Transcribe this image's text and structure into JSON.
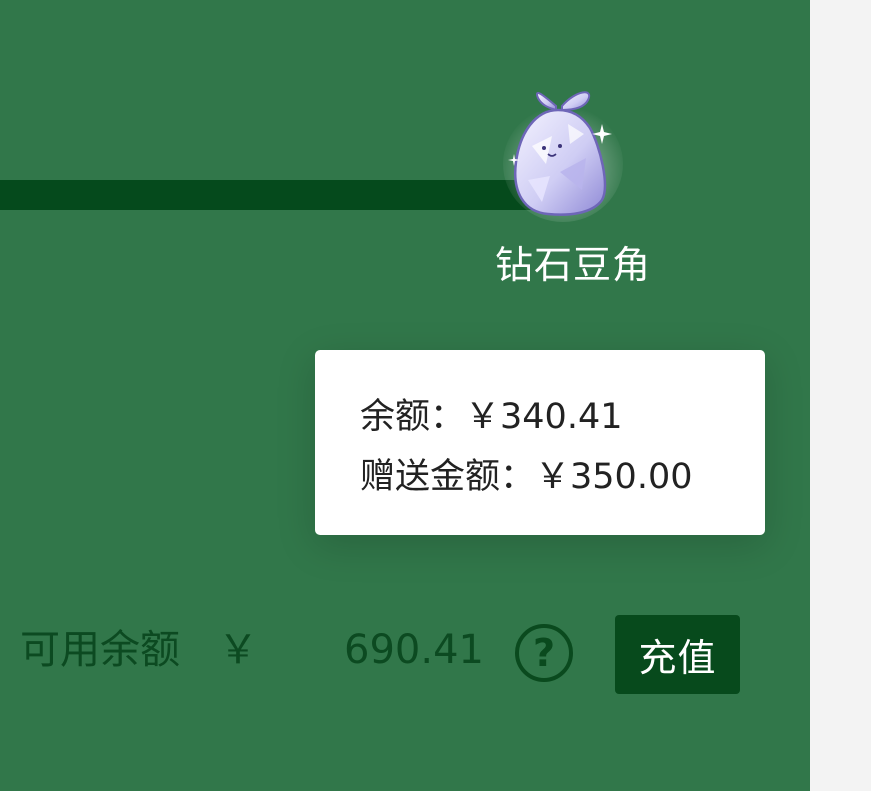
{
  "level": {
    "name": "钻石豆角",
    "mascot_icon": "diamond-bean-mascot-icon"
  },
  "balance_tooltip": {
    "balance_label": "余额：",
    "balance_value": "￥340.41",
    "bonus_label": "赠送金额：",
    "bonus_value": "￥350.00"
  },
  "available": {
    "label": "可用余额",
    "currency": "￥",
    "value": "690.41",
    "help_icon": "question-circle-icon",
    "help_glyph": "?"
  },
  "actions": {
    "recharge_label": "充值"
  },
  "colors": {
    "panel_bg": "#31774a",
    "dark_green": "#054a1c",
    "tooltip_bg": "#ffffff",
    "text_dark_green": "#0c4a21"
  }
}
